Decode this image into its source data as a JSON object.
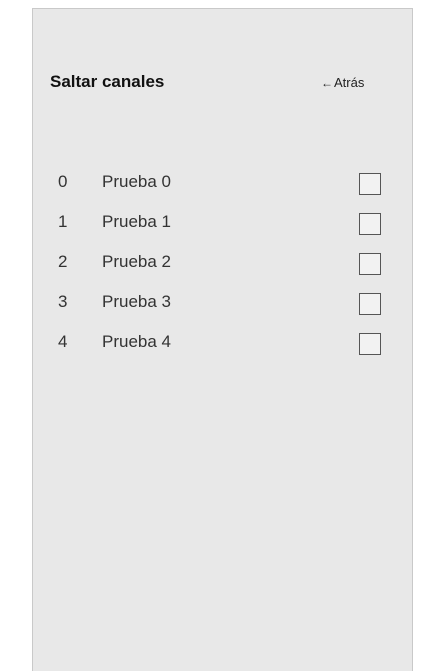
{
  "header": {
    "title": "Saltar canales",
    "back_icon": "arrow-left-icon",
    "back_arrow": "←",
    "back_label": "Atrás"
  },
  "channels": [
    {
      "number": "0",
      "name": "Prueba 0",
      "skip": false
    },
    {
      "number": "1",
      "name": "Prueba 1",
      "skip": false
    },
    {
      "number": "2",
      "name": "Prueba 2",
      "skip": false
    },
    {
      "number": "3",
      "name": "Prueba 3",
      "skip": false
    },
    {
      "number": "4",
      "name": "Prueba 4",
      "skip": false
    }
  ]
}
